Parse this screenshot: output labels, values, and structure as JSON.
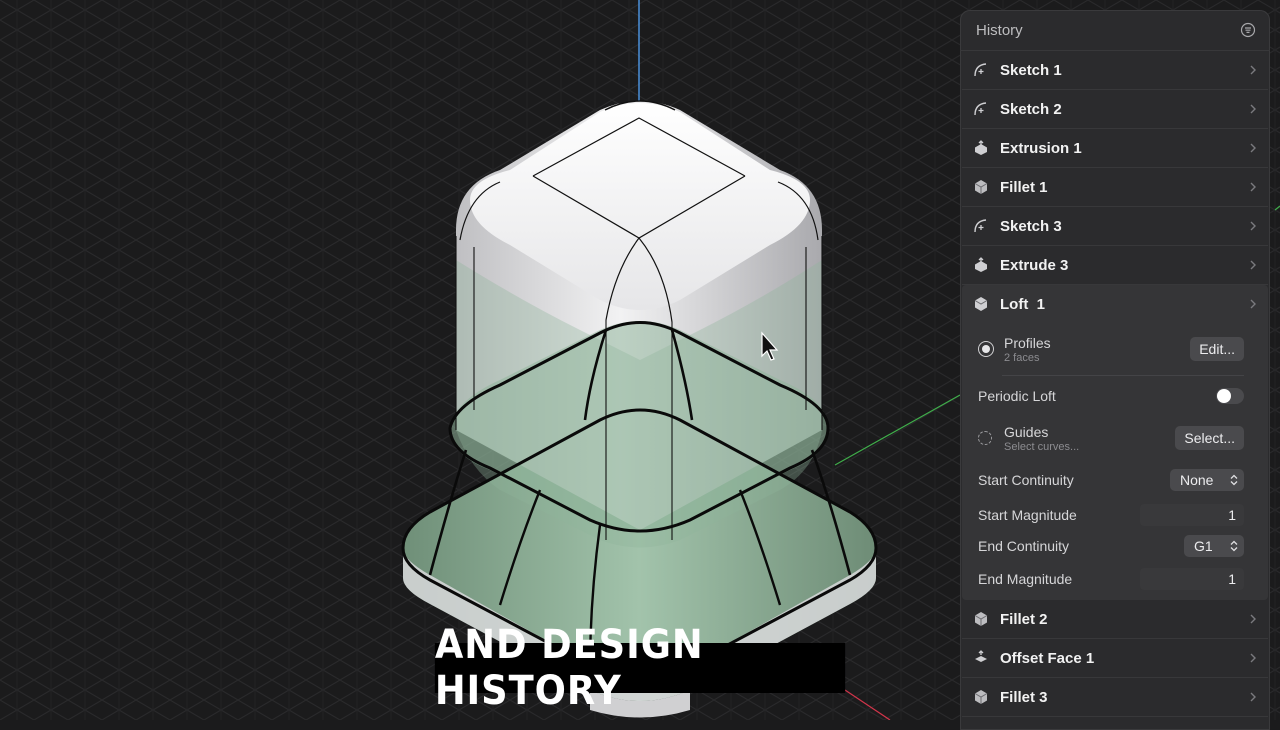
{
  "caption": "AND DESIGN HISTORY",
  "panel": {
    "title": "History",
    "items_before": [
      {
        "label": "Sketch 1",
        "icon": "sketch-icon"
      },
      {
        "label": "Sketch 2",
        "icon": "sketch-icon"
      },
      {
        "label": "Extrusion 1",
        "icon": "extrude-icon"
      },
      {
        "label": "Fillet 1",
        "icon": "fillet-icon"
      },
      {
        "label": "Sketch 3",
        "icon": "sketch-icon"
      },
      {
        "label": "Extrude 3",
        "icon": "extrude-icon"
      }
    ],
    "loft": {
      "label": "Loft  1",
      "icon": "loft-icon",
      "profiles_label": "Profiles",
      "profiles_sub": "2 faces",
      "profiles_button": "Edit...",
      "periodic_label": "Periodic Loft",
      "periodic_on": false,
      "guides_label": "Guides",
      "guides_sub": "Select curves...",
      "guides_button": "Select...",
      "start_continuity_label": "Start Continuity",
      "start_continuity_value": "None",
      "start_magnitude_label": "Start Magnitude",
      "start_magnitude_value": "1",
      "end_continuity_label": "End Continuity",
      "end_continuity_value": "G1",
      "end_magnitude_label": "End Magnitude",
      "end_magnitude_value": "1"
    },
    "items_after": [
      {
        "label": "Fillet 2",
        "icon": "fillet-icon"
      },
      {
        "label": "Offset Face 1",
        "icon": "offset-face-icon"
      },
      {
        "label": "Fillet 3",
        "icon": "fillet-icon"
      }
    ]
  },
  "colors": {
    "background": "#1b1b1c",
    "panel": "#2b2b2d",
    "loft_surface": "#8fb49a",
    "axis_blue": "#4a90d9",
    "axis_green": "#3fae4a",
    "axis_red": "#d2354a"
  }
}
